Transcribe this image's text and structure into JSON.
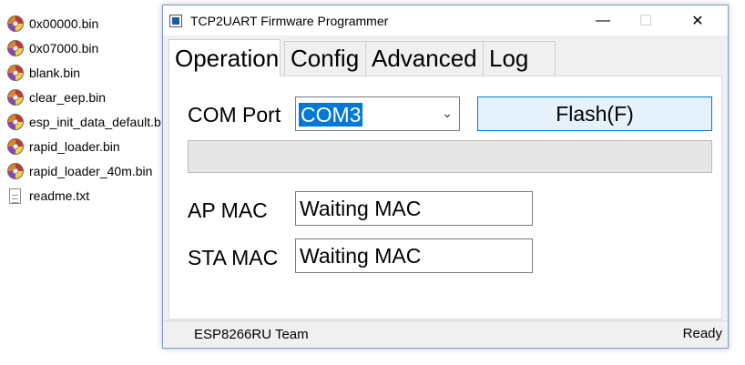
{
  "explorer": {
    "files": [
      {
        "name": "0x00000.bin",
        "icon": "disc-file-icon"
      },
      {
        "name": "0x07000.bin",
        "icon": "disc-file-icon"
      },
      {
        "name": "blank.bin",
        "icon": "disc-file-icon"
      },
      {
        "name": "clear_eep.bin",
        "icon": "disc-file-icon"
      },
      {
        "name": "esp_init_data_default.b",
        "icon": "disc-file-icon"
      },
      {
        "name": "rapid_loader.bin",
        "icon": "disc-file-icon"
      },
      {
        "name": "rapid_loader_40m.bin",
        "icon": "disc-file-icon"
      },
      {
        "name": "readme.txt",
        "icon": "text-file-icon"
      }
    ]
  },
  "window": {
    "title": "TCP2UART Firmware Programmer",
    "minimize_glyph": "—",
    "maximize_glyph": "☐",
    "close_glyph": "✕"
  },
  "tabs": [
    {
      "label": "Operation",
      "active": true
    },
    {
      "label": "Config",
      "active": false
    },
    {
      "label": "Advanced",
      "active": false
    },
    {
      "label": "Log",
      "active": false
    }
  ],
  "operation": {
    "com_port_label": "COM Port",
    "com_port_value": "COM3",
    "flash_button_label": "Flash(F)",
    "progress_percent": 0,
    "ap_mac_label": "AP MAC",
    "ap_mac_value": "Waiting MAC",
    "sta_mac_label": "STA MAC",
    "sta_mac_value": "Waiting MAC"
  },
  "statusbar": {
    "left_text": "ESP8266RU Team",
    "right_text": "Ready"
  },
  "colors": {
    "accent": "#0078d7",
    "button_bg": "#e5f1fb",
    "window_bg": "#f0f0f0"
  }
}
